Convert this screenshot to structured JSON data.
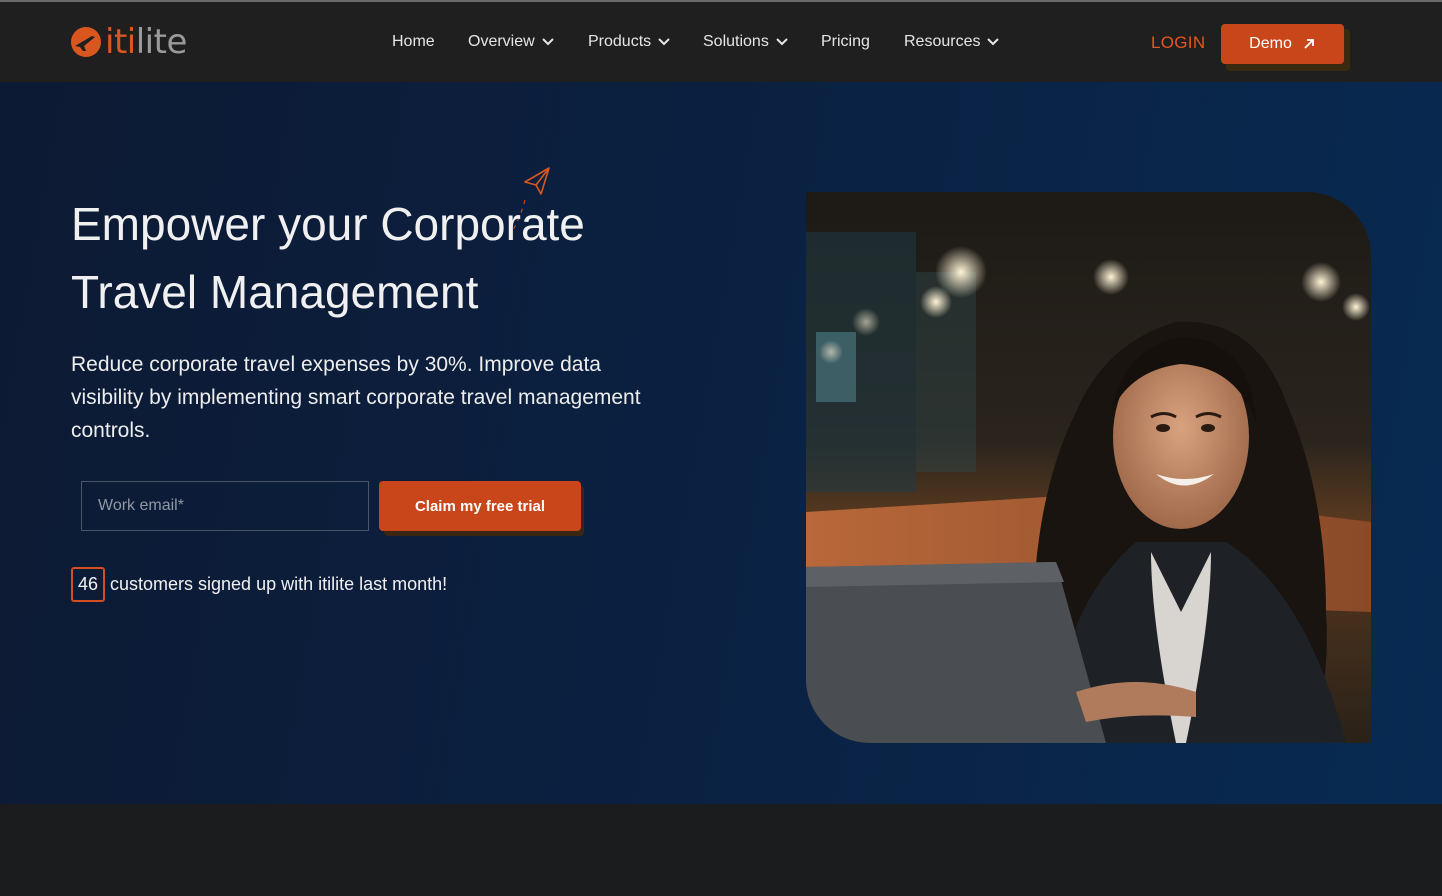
{
  "brand": {
    "name_part1": "iti",
    "name_part2": "lite",
    "logo_icon": "itilite-logo-icon",
    "accent": "#d9571f"
  },
  "nav": {
    "items": [
      {
        "label": "Home",
        "has_dropdown": false
      },
      {
        "label": "Overview",
        "has_dropdown": true
      },
      {
        "label": "Products",
        "has_dropdown": true
      },
      {
        "label": "Solutions",
        "has_dropdown": true
      },
      {
        "label": "Pricing",
        "has_dropdown": false
      },
      {
        "label": "Resources",
        "has_dropdown": true
      }
    ],
    "login_label": "LOGIN",
    "demo_label": "Demo",
    "demo_icon": "arrow-up-right-icon"
  },
  "hero": {
    "headline_line1": "Empower your Corporate",
    "headline_line2": "Travel Management",
    "subtext": "Reduce corporate travel expenses by 30%. Improve data visibility by implementing smart corporate travel management controls.",
    "email_placeholder": "Work email*",
    "email_value": "",
    "cta_label": "Claim my free trial",
    "customer_count": "46",
    "customer_text": "customers signed up with itilite last month!",
    "decor_icon": "paper-plane-icon",
    "image_subject": "smiling woman at laptop in office"
  },
  "colors": {
    "button": "#c9461a",
    "login": "#e5571c",
    "hero_bg_start": "#0d1a33",
    "hero_bg_end": "#082a52",
    "navbar_bg": "#1f1f20"
  }
}
